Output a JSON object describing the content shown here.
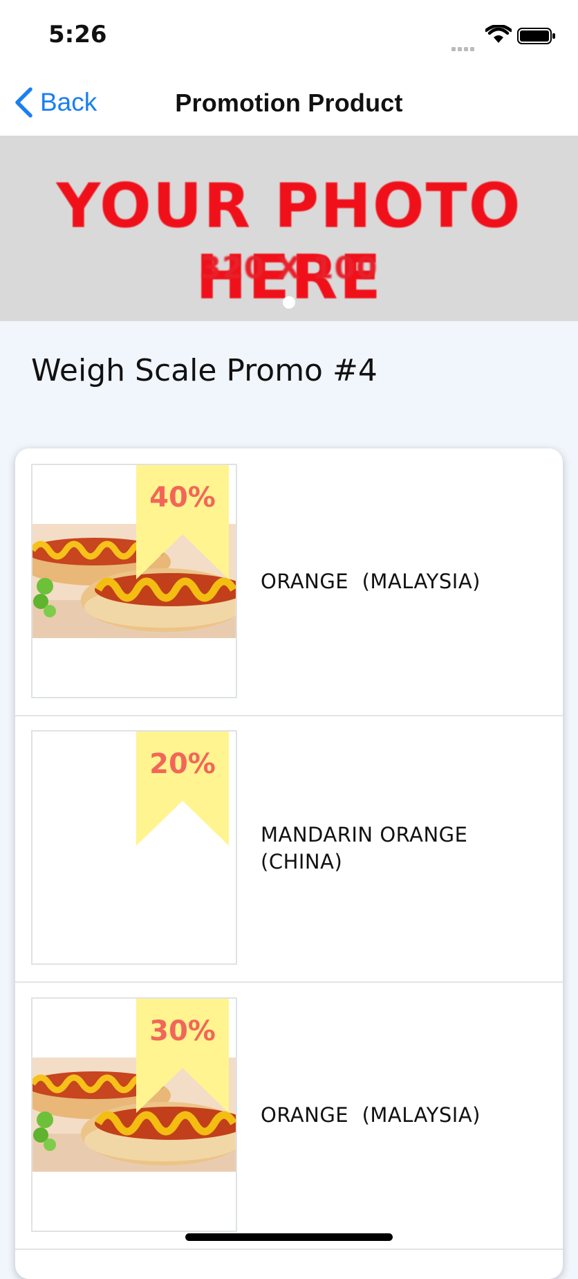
{
  "status_bar": {
    "time": "5:26"
  },
  "nav": {
    "back_label": "Back",
    "title": "Promotion Product"
  },
  "banner": {
    "headline": "YOUR PHOTO HERE",
    "subtext": "320 X 100"
  },
  "section": {
    "title": "Weigh Scale Promo #4"
  },
  "products": [
    {
      "discount": "40%",
      "name": "ORANGE  (MALAYSIA)",
      "image": "hot-dog-photo"
    },
    {
      "discount": "20%",
      "name": "MANDARIN ORANGE\n(CHINA)",
      "image": "none"
    },
    {
      "discount": "30%",
      "name": "ORANGE  (MALAYSIA)",
      "image": "hot-dog-photo"
    }
  ],
  "colors": {
    "accent": "#1a7ff2",
    "ribbon": "#fff48f",
    "discount_text": "#f26659",
    "banner_text": "#f0101a",
    "background": "#f1f5fc"
  }
}
